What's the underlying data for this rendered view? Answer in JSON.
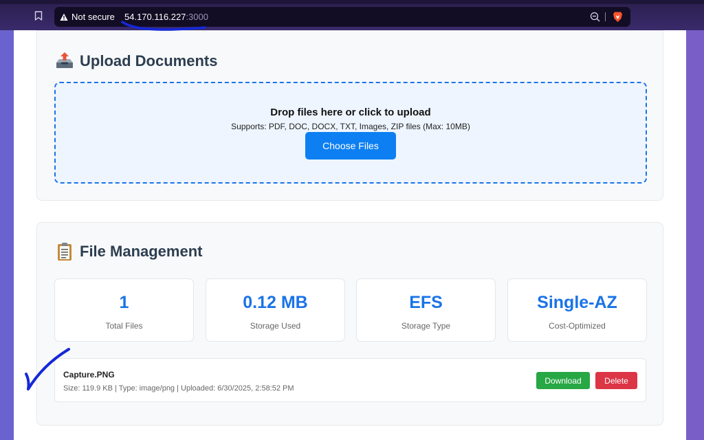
{
  "browser": {
    "security_label": "Not secure",
    "url_host": "54.170.116.227",
    "url_port": ":3000"
  },
  "upload": {
    "title": "Upload Documents",
    "drop_title": "Drop files here or click to upload",
    "drop_subtitle": "Supports: PDF, DOC, DOCX, TXT, Images, ZIP files (Max: 10MB)",
    "choose_label": "Choose Files"
  },
  "files": {
    "title": "File Management",
    "stats": [
      {
        "value": "1",
        "label": "Total Files"
      },
      {
        "value": "0.12 MB",
        "label": "Storage Used"
      },
      {
        "value": "EFS",
        "label": "Storage Type"
      },
      {
        "value": "Single-AZ",
        "label": "Cost-Optimized"
      }
    ],
    "items": [
      {
        "name": "Capture.PNG",
        "meta": "Size: 119.9 KB | Type: image/png | Uploaded: 6/30/2025, 2:58:52 PM",
        "download_label": "Download",
        "delete_label": "Delete"
      }
    ]
  },
  "colors": {
    "accent": "#1a73e8",
    "download": "#28a745",
    "delete": "#dc3545",
    "annotation": "#1428d8"
  },
  "icons": [
    "bookmark-icon",
    "warning-icon",
    "zoom-icon",
    "brave-lion-icon",
    "upload-tray-icon",
    "clipboard-icon"
  ]
}
